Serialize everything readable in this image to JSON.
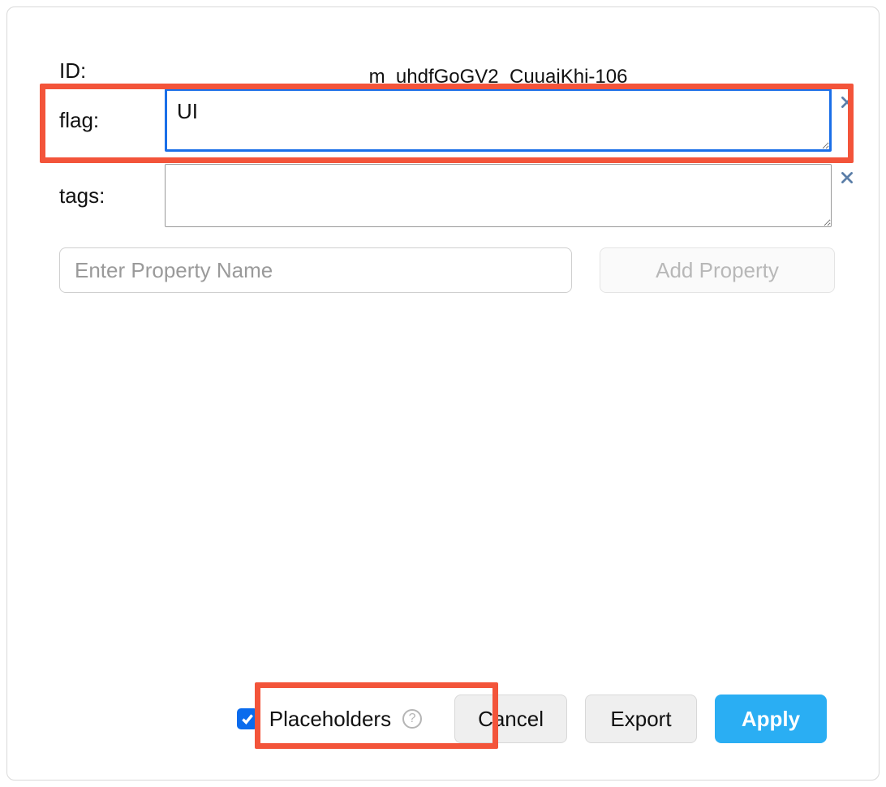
{
  "form": {
    "id_label": "ID:",
    "id_value": "m_uhdfGoGV2_CuuajKhi-106",
    "flag_label": "flag:",
    "flag_value": "UI",
    "tags_label": "tags:",
    "tags_value": "",
    "prop_name_placeholder": "Enter Property Name",
    "add_prop_label": "Add Property"
  },
  "footer": {
    "placeholders_label": "Placeholders",
    "placeholders_checked": true,
    "help_glyph": "?",
    "cancel_label": "Cancel",
    "export_label": "Export",
    "apply_label": "Apply"
  },
  "colors": {
    "highlight": "#f3543a",
    "focus_border": "#1a6fe8",
    "primary": "#2aaef3",
    "checkbox": "#0a6bed"
  }
}
